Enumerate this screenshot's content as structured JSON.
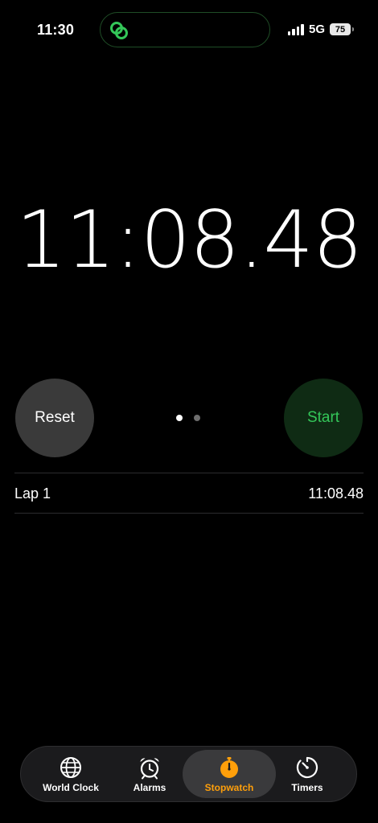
{
  "status_bar": {
    "time": "11:30",
    "network": "5G",
    "battery": "75",
    "island_icon": "link-rings-icon",
    "island_icon_color": "#34c759"
  },
  "stopwatch": {
    "elapsed": "11:08.48"
  },
  "controls": {
    "reset_label": "Reset",
    "start_label": "Start",
    "page_indicator": {
      "total": 2,
      "active": 1
    }
  },
  "laps": [
    {
      "label": "Lap 1",
      "time": "11:08.48"
    }
  ],
  "tab_bar": {
    "tabs": [
      {
        "label": "World Clock",
        "icon": "globe-icon",
        "selected": false
      },
      {
        "label": "Alarms",
        "icon": "alarm-clock-icon",
        "selected": false
      },
      {
        "label": "Stopwatch",
        "icon": "stopwatch-icon",
        "selected": true
      },
      {
        "label": "Timers",
        "icon": "timer-icon",
        "selected": false
      }
    ],
    "accent_color": "#ff9f0a"
  },
  "colors": {
    "start_text": "#34c759",
    "start_bg": "#0f2b14",
    "reset_bg": "#3a3a3a"
  }
}
